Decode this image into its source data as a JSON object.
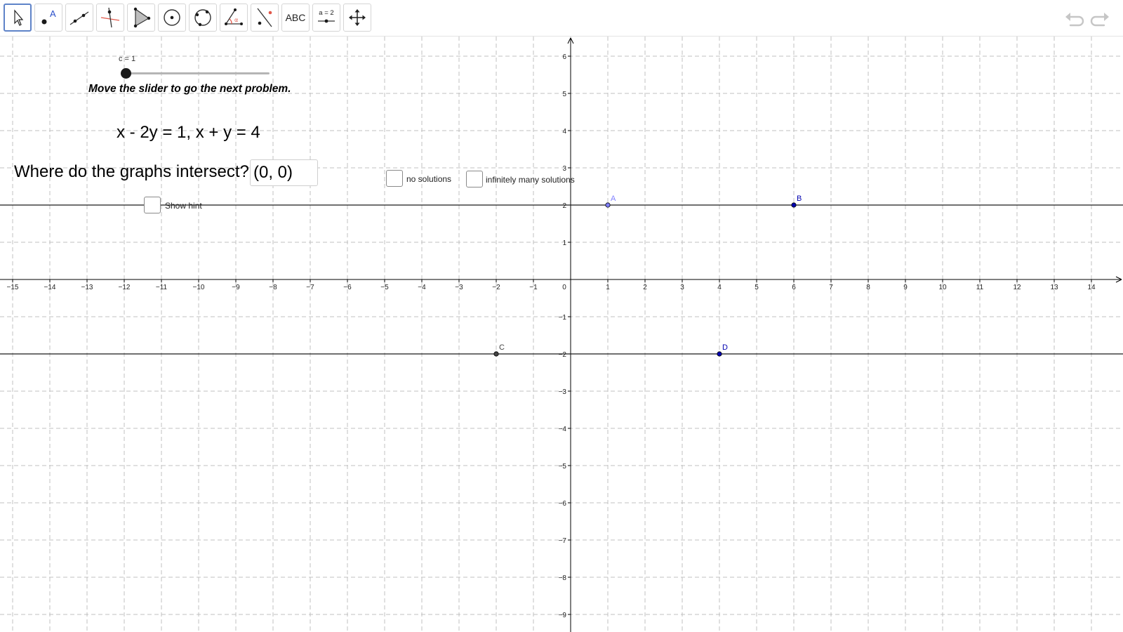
{
  "toolbar": {
    "tools": [
      {
        "name": "move-tool",
        "label": ""
      },
      {
        "name": "point-tool",
        "label": "A"
      },
      {
        "name": "line-tool",
        "label": ""
      },
      {
        "name": "perpendicular-line-tool",
        "label": ""
      },
      {
        "name": "polygon-tool",
        "label": ""
      },
      {
        "name": "circle-tool",
        "label": ""
      },
      {
        "name": "circle-through-three-points-tool",
        "label": ""
      },
      {
        "name": "angle-tool",
        "label": ""
      },
      {
        "name": "reflect-tool",
        "label": ""
      },
      {
        "name": "text-tool",
        "label": "ABC"
      },
      {
        "name": "slider-tool",
        "label": "a = 2"
      },
      {
        "name": "move-graphics-view-tool",
        "label": ""
      }
    ],
    "selected_tool": "move-tool",
    "undo_icon": "undo-icon",
    "redo_icon": "redo-icon"
  },
  "slider": {
    "caption": "c = 1",
    "value": 1,
    "position_fraction": 0.0
  },
  "instruction": "Move the slider to go the next problem.",
  "equations": "x - 2y = 1, x + y = 4",
  "question": {
    "label": "Where do the graphs intersect?",
    "input_value": "(0, 0)"
  },
  "checkboxes": {
    "no_solutions": {
      "label": "no solutions",
      "checked": false
    },
    "infinitely_many": {
      "label": "infinitely many solutions",
      "checked": false
    },
    "show_hint": {
      "label": "Show hint",
      "checked": false
    }
  },
  "graph": {
    "x_range": [
      -15,
      15
    ],
    "y_range": [
      -9,
      6
    ],
    "x_ticks": [
      "-15",
      "-14",
      "-13",
      "-12",
      "-11",
      "-10",
      "-9",
      "-8",
      "-7",
      "-6",
      "-5",
      "-4",
      "-3",
      "-2",
      "-1",
      "0",
      "1",
      "2",
      "3",
      "4",
      "5",
      "6",
      "7",
      "8",
      "9",
      "10",
      "11",
      "12",
      "13",
      "14"
    ],
    "y_ticks": [
      "6",
      "5",
      "4",
      "3",
      "2",
      "1",
      "-1",
      "-2",
      "-3",
      "-4",
      "-5",
      "-6",
      "-7",
      "-8",
      "-9"
    ],
    "grid": true,
    "points": [
      {
        "label": "A",
        "x": 1,
        "y": 2,
        "color": "#7f7fff"
      },
      {
        "label": "B",
        "x": 6,
        "y": 2,
        "color": "#0000b0"
      },
      {
        "label": "C",
        "x": -2,
        "y": -2,
        "color": "#444444"
      },
      {
        "label": "D",
        "x": 4,
        "y": -2,
        "color": "#0000b0"
      }
    ],
    "lines": [
      {
        "through": [
          "A",
          "B"
        ],
        "y": 2
      },
      {
        "through": [
          "C",
          "D"
        ],
        "y": -2
      }
    ]
  },
  "colors": {
    "accent": "#5e83c8",
    "grid": "#c0c0c0",
    "axis": "#000000",
    "line": "#1a1a1a"
  }
}
